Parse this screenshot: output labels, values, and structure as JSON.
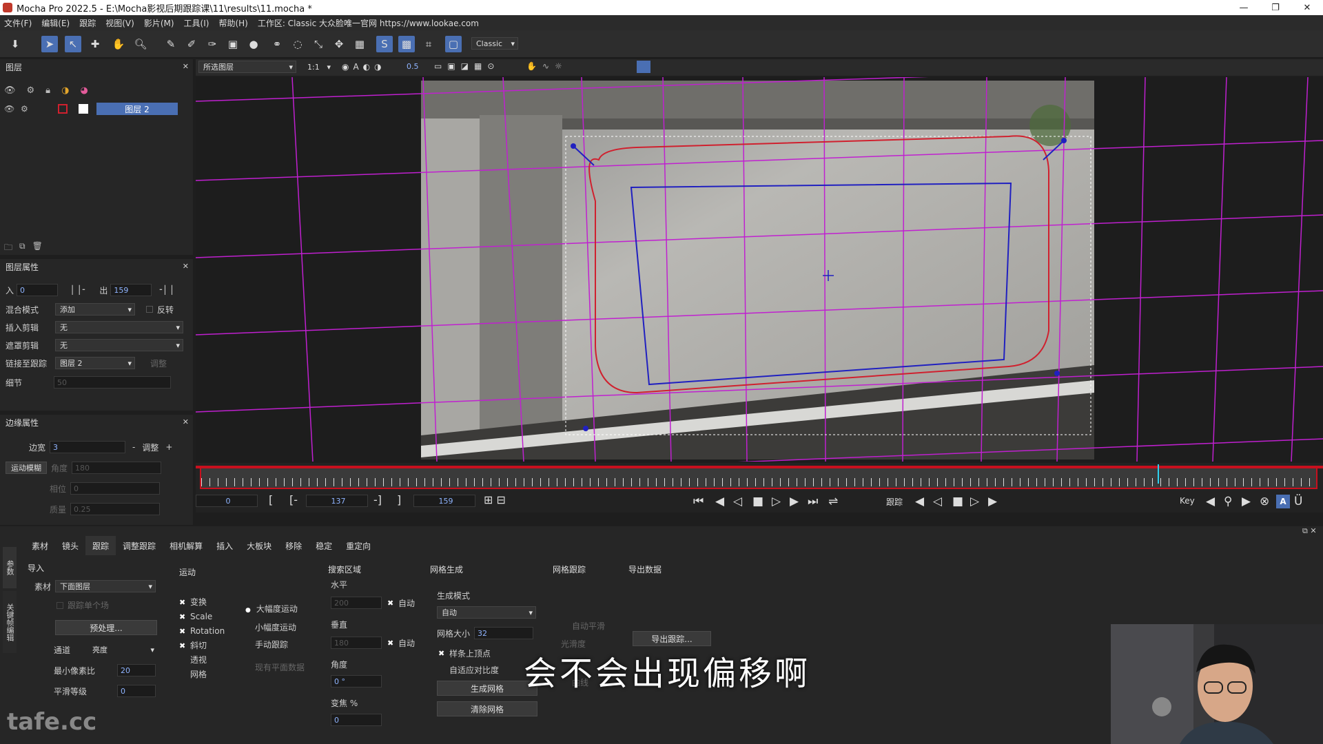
{
  "window": {
    "title": "Mocha Pro 2022.5 - E:\\Mocha影视后期跟踪课\\11\\results\\11.mocha *",
    "minimize": "—",
    "restore": "❐",
    "close": "✕"
  },
  "menu": [
    "文件(F)",
    "编辑(E)",
    "跟踪",
    "视图(V)",
    "影片(M)",
    "工具(I)",
    "帮助(H)",
    "工作区: Classic 大众脸唯一官网 https://www.lookae.com"
  ],
  "toolbar": {
    "workspace": "Classic"
  },
  "viewer_bar": {
    "layer_select": "所选图层",
    "zoom": "1:1",
    "opacity": "0.5"
  },
  "layers_panel": {
    "title": "图层",
    "layers": [
      {
        "name": "图层 2"
      }
    ]
  },
  "layer_props": {
    "title": "图层属性",
    "in_label": "入",
    "in_value": "0",
    "out_label": "出",
    "out_value": "159",
    "blend_label": "混合模式",
    "blend_value": "添加",
    "invert_label": "反转",
    "insert_clip_label": "插入剪辑",
    "insert_clip_value": "无",
    "matte_clip_label": "遮罩剪辑",
    "matte_clip_value": "无",
    "link_label": "链接至跟踪",
    "link_value": "图层 2",
    "adjust_label": "调整",
    "detail_label": "细节",
    "detail_value": "50"
  },
  "edge_props": {
    "title": "边缘属性",
    "width_label": "边宽",
    "width_value": "3",
    "adjust_label": "调整",
    "motion_blur_btn": "运动模糊",
    "angle_label": "角度",
    "angle_value": "180",
    "phase_label": "相位",
    "phase_value": "0",
    "quality_label": "质量",
    "quality_value": "0.25"
  },
  "timeline": {
    "start": "0",
    "current": "137",
    "end": "159",
    "track_label": "跟踪",
    "key_label": "Key",
    "playhead_fraction": 0.86
  },
  "modules": {
    "side_tabs": [
      "参数",
      "关键帧编辑"
    ],
    "tabs": [
      "素材",
      "镜头",
      "跟踪",
      "调整跟踪",
      "相机解算",
      "插入",
      "大板块",
      "移除",
      "稳定",
      "重定向"
    ],
    "active_tab": 2
  },
  "track_panel": {
    "import_title": "导入",
    "clip_label": "素材",
    "clip_value": "下面图层",
    "track_single": "跟踪单个场",
    "preprocess_btn": "预处理...",
    "channel_label": "通道",
    "channel_value": "亮度",
    "min_pixels_label": "最小像素比",
    "min_pixels_value": "20",
    "smooth_label": "平滑等级",
    "smooth_value": "0",
    "motion_title": "运动",
    "motion_items": [
      {
        "label": "变换",
        "checked": true
      },
      {
        "label": "Scale",
        "checked": true
      },
      {
        "label": "Rotation",
        "checked": true
      },
      {
        "label": "斜切",
        "checked": true
      },
      {
        "label": "透视",
        "checked": false
      },
      {
        "label": "网格",
        "checked": false
      }
    ],
    "motion_modes": [
      "大幅度运动",
      "小幅度运动",
      "手动跟踪"
    ],
    "existing_planar": "现有平面数据",
    "search_title": "搜索区域",
    "horizontal_label": "水平",
    "horizontal_value": "200",
    "auto1": "自动",
    "vertical_label": "垂直",
    "vertical_value": "180",
    "auto2": "自动",
    "angle_label": "角度",
    "angle_value": "0 °",
    "zoom_label": "变焦 %",
    "zoom_value": "0",
    "mesh_title": "网格生成",
    "gen_mode_label": "生成模式",
    "gen_mode_value": "自动",
    "mesh_size_label": "网格大小",
    "mesh_size_value": "32",
    "spline_vertex": "样条上顶点",
    "adaptive": "自适应对比度",
    "gen_mesh_btn": "生成网格",
    "clear_mesh_btn": "清除网格",
    "mesh_track_title": "网格跟踪",
    "auto_smooth": "自动平滑",
    "smooth_lbl": "光滑度",
    "curve_lbl": "曲线",
    "export_title": "导出数据",
    "export_btn": "导出跟踪..."
  },
  "subtitle": "会不会出现偏移啊",
  "watermark": "tafe.cc",
  "colors": {
    "accent": "#4a6fb3",
    "grid": "#c020d0",
    "spline": "#d0202e",
    "surface": "#2020c0",
    "timeline_red": "#c8101e"
  }
}
